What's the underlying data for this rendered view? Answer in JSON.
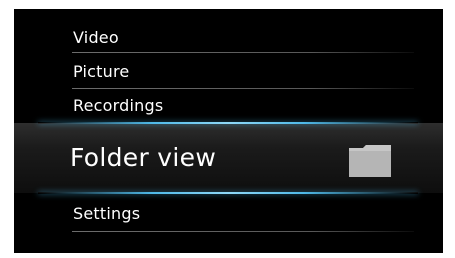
{
  "menu": {
    "items": [
      {
        "label": "Video"
      },
      {
        "label": "Picture"
      },
      {
        "label": "Recordings"
      },
      {
        "label": "Folder view",
        "selected": true,
        "icon": "folder-icon"
      },
      {
        "label": "Settings"
      }
    ]
  },
  "colors": {
    "background": "#000000",
    "text": "#ffffff",
    "selection_glow": "#4fb9e8",
    "icon": "#b0b0b0"
  }
}
